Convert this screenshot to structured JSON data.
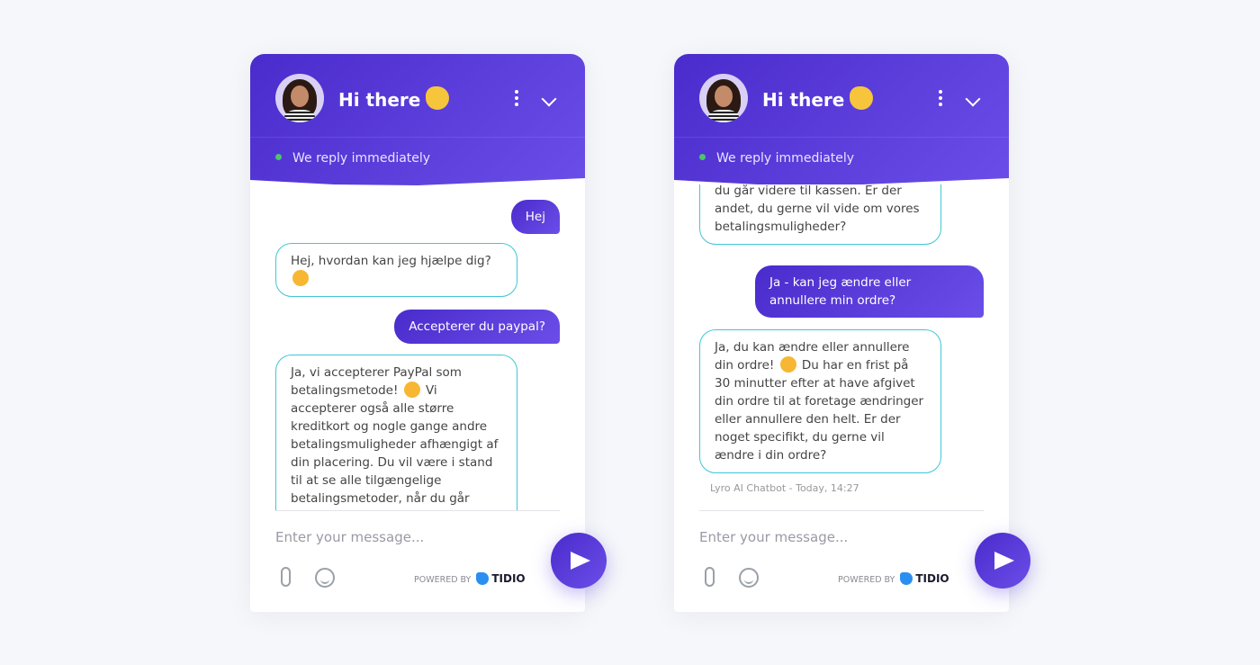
{
  "colors": {
    "accent": "#5a3bdc",
    "bot_border": "#3fc6d6",
    "online": "#4cc46b"
  },
  "header": {
    "title": "Hi there",
    "status": "We reply immediately",
    "icons": [
      "avatar",
      "waving-hand-icon",
      "more-vertical-icon",
      "chevron-down-icon"
    ]
  },
  "footer": {
    "placeholder": "Enter your message...",
    "powered_by": "POWERED BY",
    "brand": "TIDIO"
  },
  "left": {
    "m1": "Hej",
    "m2": "Hej, hvordan kan jeg hjælpe dig?",
    "m3": "Accepterer du paypal?",
    "m4a": "Ja, vi accepterer PayPal som betalingsmetode!",
    "m4b": " Vi accepterer også alle større kreditkort og nogle gange andre betalingsmuligheder afhængigt af din placering. Du vil være i stand til at se alle tilgængelige betalingsmetoder, når du går videre til kassen. Er der andet, du gerne vil vide om vores betalingsmuligheder?"
  },
  "right": {
    "m1": "du går videre til kassen. Er der andet, du gerne vil vide om vores betalingsmuligheder?",
    "m2": "Ja - kan jeg ændre eller annullere min ordre?",
    "m3a": "Ja, du kan ændre eller annullere din ordre!",
    "m3b": " Du har en frist på 30 minutter efter at have afgivet din ordre til at foretage ændringer eller annullere den helt. Er der noget specifikt, du gerne vil ændre i din ordre?",
    "timestamp": "Lyro AI Chatbot - Today, 14:27"
  }
}
